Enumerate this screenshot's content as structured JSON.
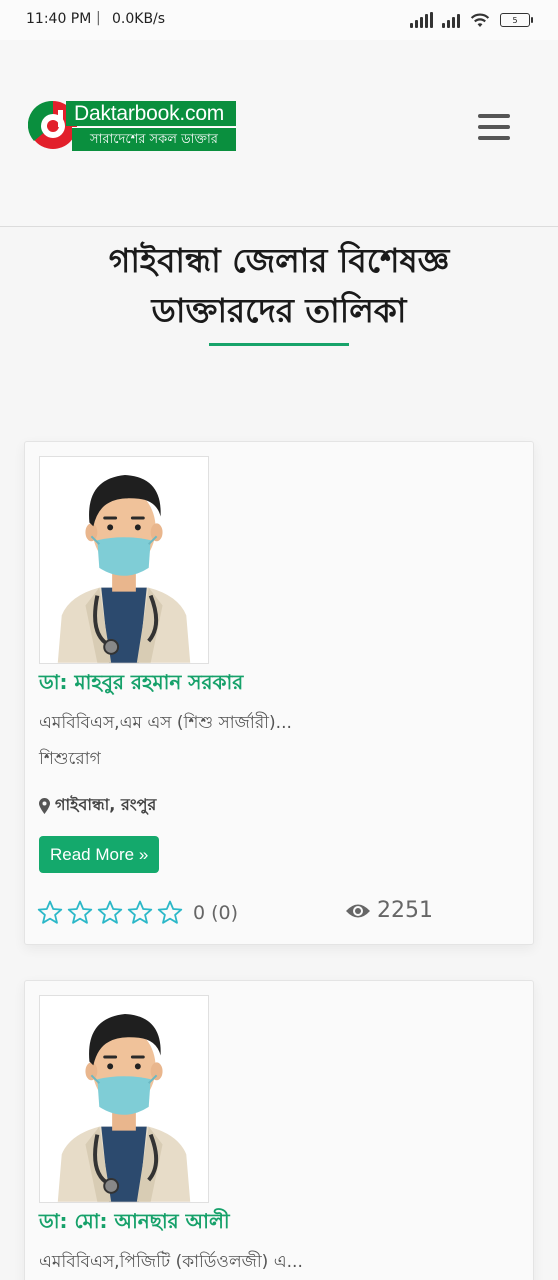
{
  "status_bar": {
    "time": "11:40 PM",
    "separator": "|",
    "net_speed": "0.0KB/s",
    "battery": "5"
  },
  "header": {
    "logo_title": "Daktarbook.com",
    "logo_tagline": "সারাদেশের সকল ডাক্তার",
    "menu_icon": "hamburger-menu-icon"
  },
  "page": {
    "title_line1": "গাইবান্ধা জেলার বিশেষজ্ঞ",
    "title_line2": "ডাক্তারদের তালিকা"
  },
  "doctors": [
    {
      "name": "ডা: মাহবুর রহমান সরকার",
      "degree": "এমবিবিএস,এম এস (শিশু সার্জারী)...",
      "specialty": "শিশুরোগ",
      "location": "গাইবান্ধা, রংপুর",
      "button": "Read More »",
      "rating": "0 (0)",
      "views": "2251"
    },
    {
      "name": "ডা: মো: আনছার আলী",
      "degree": "এমবিবিএস,পিজিটি (কার্ডিওলজী) এ..."
    }
  ],
  "colors": {
    "accent_green": "#16a16a",
    "button_green": "#14a96c",
    "star_outline": "#2bb8c8"
  }
}
